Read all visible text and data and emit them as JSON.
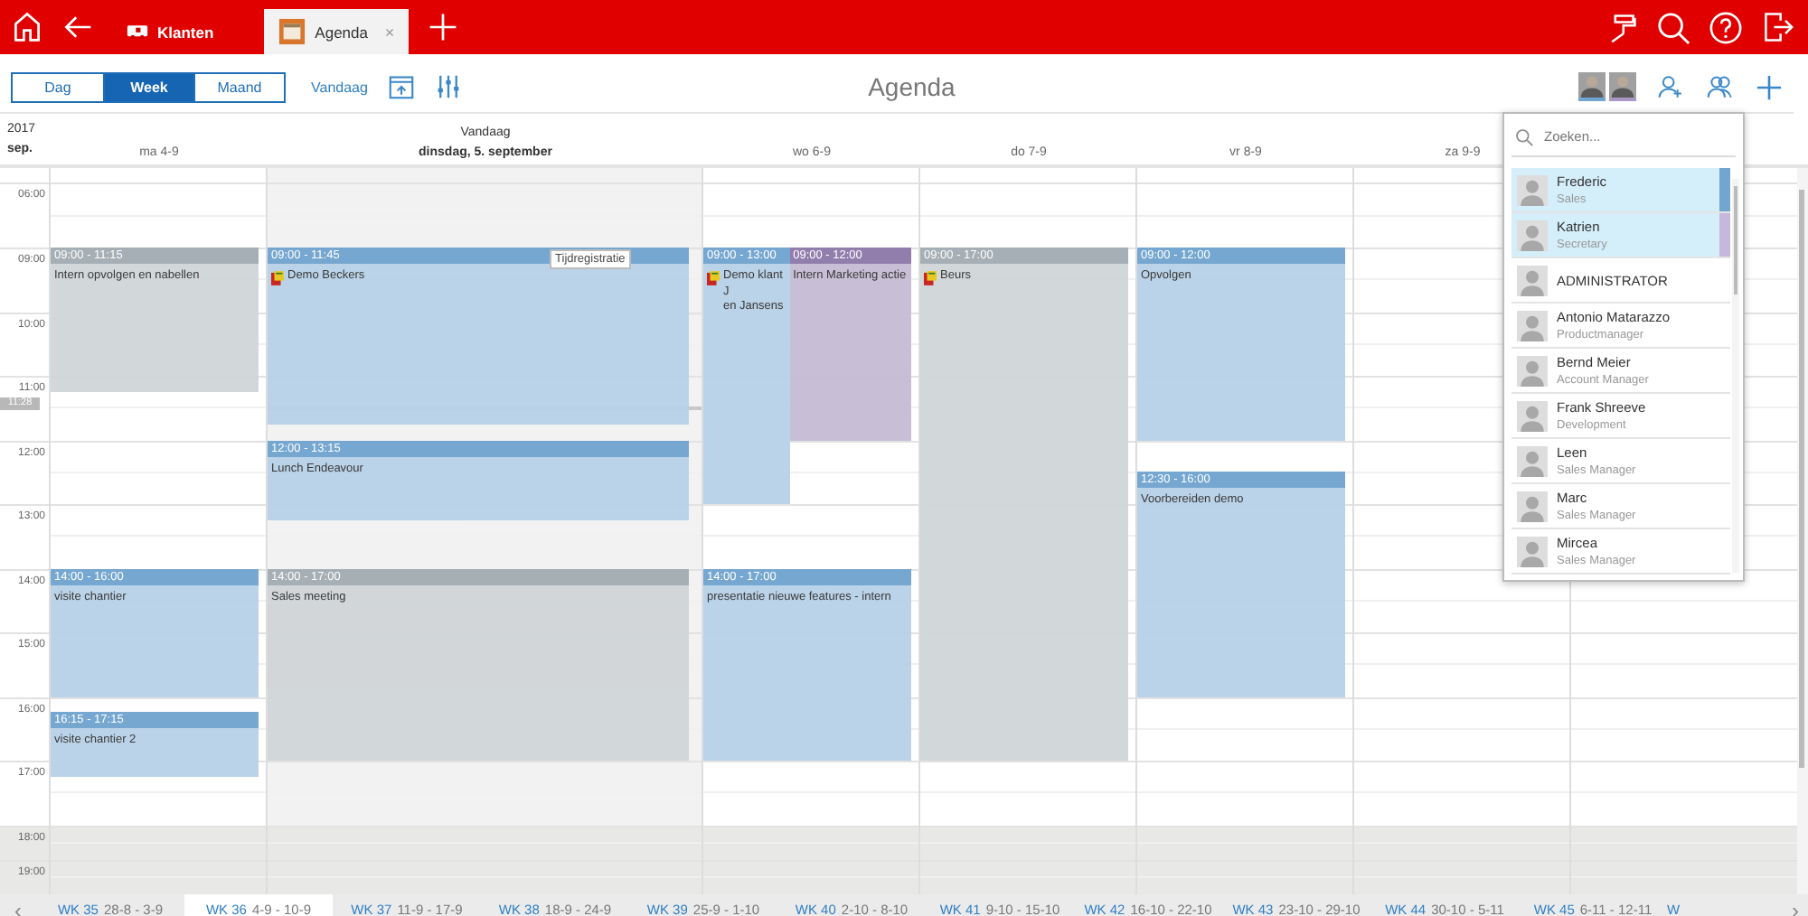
{
  "top_bar": {
    "tabs": [
      {
        "label": "Klanten",
        "selected": false
      },
      {
        "label": "Agenda",
        "selected": true,
        "close": "×"
      }
    ]
  },
  "toolbar": {
    "views": [
      {
        "label": "Dag",
        "selected": false
      },
      {
        "label": "Week",
        "selected": true
      },
      {
        "label": "Maand",
        "selected": false
      }
    ],
    "today_link": "Vandaag",
    "title": "Agenda",
    "avatars": [
      {
        "color": "#72a5d0"
      },
      {
        "color": "#a998c4"
      }
    ]
  },
  "header": {
    "year": "2017",
    "month": "sep.",
    "today_label": "Vandaag"
  },
  "days": [
    {
      "label": "ma 4-9",
      "today": false,
      "events": [
        {
          "time": "09:00 - 11:15",
          "title": "Intern opvolgen en nabellen",
          "color": "#a3adb3",
          "icon": false
        },
        {
          "time": "14:00 - 16:00",
          "title": "visite chantier",
          "color": "#72a5d0",
          "icon": false
        },
        {
          "time": "16:15 - 17:15",
          "title": "visite chantier 2",
          "color": "#72a5d0",
          "icon": false
        }
      ]
    },
    {
      "label": "dinsdag, 5. september",
      "today": true,
      "events": [
        {
          "time": "09:00 - 11:45",
          "title": "Demo Beckers",
          "color": "#72a5d0",
          "icon": true
        },
        {
          "time": "12:00 - 13:15",
          "title": "Lunch Endeavour",
          "color": "#72a5d0",
          "icon": false
        },
        {
          "time": "14:00 - 17:00",
          "title": "Sales meeting",
          "color": "#a3adb3",
          "icon": false
        }
      ]
    },
    {
      "label": "wo 6-9",
      "today": false,
      "events": [
        {
          "time": "09:00 - 13:00",
          "title": "Demo klant J",
          "title_2": "en Jansens",
          "color": "#72a5d0",
          "icon": true
        },
        {
          "time": "09:00 - 12:00",
          "title": "Intern Marketing actie",
          "color": "#8f7aab",
          "icon": false
        },
        {
          "time": "14:00 - 17:00",
          "title": "presentatie nieuwe features - intern",
          "color": "#72a5d0",
          "icon": false
        }
      ]
    },
    {
      "label": "do 7-9",
      "today": false,
      "events": [
        {
          "time": "09:00 - 17:00",
          "title": "Beurs",
          "color": "#a3adb3",
          "icon": true
        }
      ]
    },
    {
      "label": "vr 8-9",
      "today": false,
      "events": [
        {
          "time": "09:00 - 12:00",
          "title": "Opvolgen",
          "color": "#72a5d0",
          "icon": false
        },
        {
          "time": "12:30 - 16:00",
          "title": "Voorbereiden demo",
          "color": "#72a5d0",
          "icon": false
        }
      ]
    },
    {
      "label": "za 9-9",
      "today": false
    }
  ],
  "hours": [
    {
      "label": "06:00",
      "off_hours": false
    },
    {
      "label": "09:00",
      "off_hours": false
    },
    {
      "label": "10:00",
      "off_hours": false
    },
    {
      "label": "11:00",
      "off_hours": false
    },
    {
      "label": "12:00",
      "off_hours": false
    },
    {
      "label": "13:00",
      "off_hours": false
    },
    {
      "label": "14:00",
      "off_hours": false
    },
    {
      "label": "15:00",
      "off_hours": false
    },
    {
      "label": "16:00",
      "off_hours": false
    },
    {
      "label": "17:00",
      "off_hours": false
    },
    {
      "label": "18:00",
      "off_hours": true
    },
    {
      "label": "19:00",
      "off_hours": true
    }
  ],
  "now_marker": "11:28",
  "tooltip": "Tijdregistratie",
  "user_dropdown": {
    "search": {
      "placeholder": "Zoeken..."
    },
    "users": [
      {
        "name": "Frederic",
        "role": "Sales",
        "selected": true,
        "color": "#72a5d0"
      },
      {
        "name": "Katrien",
        "role": "Secretary",
        "selected": true,
        "color": "#c6b8da"
      },
      {
        "name": "ADMINISTRATOR",
        "selected": false
      },
      {
        "name": "Antonio Matarazzo",
        "role": "Productmanager",
        "selected": false
      },
      {
        "name": "Bernd Meier",
        "role": "Account Manager",
        "selected": false
      },
      {
        "name": "Frank Shreeve",
        "role": "Development",
        "selected": false
      },
      {
        "name": "Leen",
        "role": "Sales Manager",
        "selected": false
      },
      {
        "name": "Marc",
        "role": "Sales Manager",
        "selected": false
      },
      {
        "name": "Mircea",
        "role": "Sales Manager",
        "selected": false
      }
    ]
  },
  "week_strip": {
    "prev": "‹",
    "next": "›",
    "weeks": [
      {
        "week": "WK 35",
        "range": "28-8 - 3-9",
        "selected": false
      },
      {
        "week": "WK 36",
        "range": "4-9 - 10-9",
        "selected": true
      },
      {
        "week": "WK 37",
        "range": "11-9 - 17-9",
        "selected": false
      },
      {
        "week": "WK 38",
        "range": "18-9 - 24-9",
        "selected": false
      },
      {
        "week": "WK 39",
        "range": "25-9 - 1-10",
        "selected": false
      },
      {
        "week": "WK 40",
        "range": "2-10 - 8-10",
        "selected": false
      },
      {
        "week": "WK 41",
        "range": "9-10 - 15-10",
        "selected": false
      },
      {
        "week": "WK 42",
        "range": "16-10 - 22-10",
        "selected": false
      },
      {
        "week": "WK 43",
        "range": "23-10 - 29-10",
        "selected": false
      },
      {
        "week": "WK 44",
        "range": "30-10 - 5-11",
        "selected": false
      },
      {
        "week": "WK 45",
        "range": "6-11 - 12-11",
        "selected": false
      },
      {
        "week": "W",
        "selected": false
      }
    ]
  }
}
